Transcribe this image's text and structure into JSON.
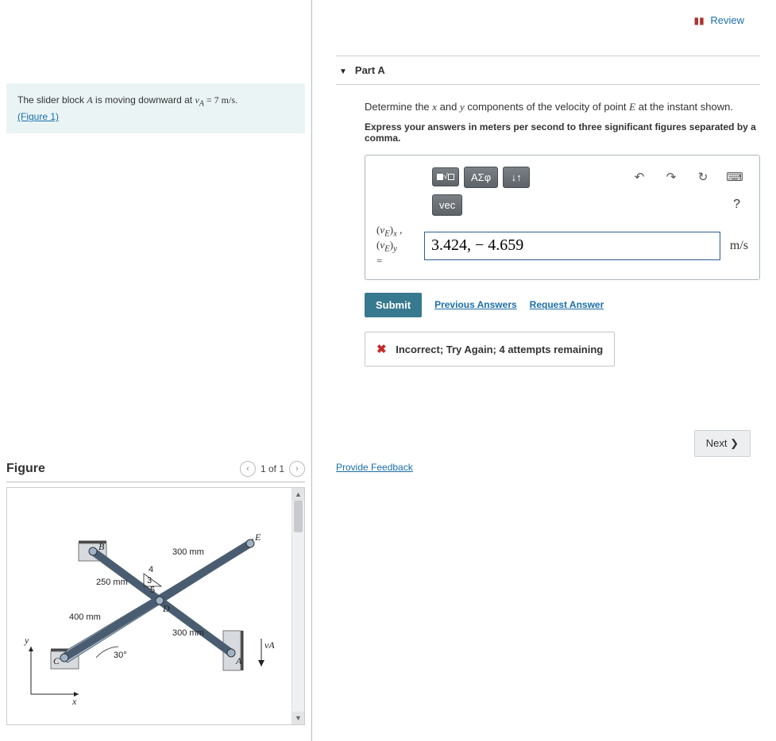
{
  "review_label": " Review",
  "problem": {
    "intro_pre": "The slider block ",
    "intro_var1": "A",
    "intro_mid": " is moving downward at ",
    "intro_eq": "v",
    "intro_sub": "A",
    "intro_val": " = 7 m/s.",
    "figure_link": "(Figure 1)"
  },
  "part": {
    "label": "Part A",
    "desc_pre": "Determine the ",
    "desc_x": "x",
    "desc_mid1": " and ",
    "desc_y": "y",
    "desc_mid2": " components of the velocity of point ",
    "desc_E": "E",
    "desc_post": " at the instant shown.",
    "instructions": "Express your answers in meters per second to three significant figures separated by a comma."
  },
  "toolbar": {
    "templates": "▢√▢",
    "greek": "ΑΣφ",
    "updown": "↓↑",
    "undo": "↶",
    "redo": "↷",
    "reset": "↻",
    "keyboard": "⌨",
    "vec": "vec",
    "help": "?"
  },
  "answer": {
    "label_x": "(vE)x",
    "label_y": "(vE)y",
    "label_eq": "=",
    "value": "3.424, − 4.659",
    "unit": "m/s"
  },
  "actions": {
    "submit": "Submit",
    "previous": "Previous Answers",
    "request": "Request Answer"
  },
  "feedback": {
    "text_pre": "Incorrect; Try Again; ",
    "attempts": "4 attempts remaining"
  },
  "footer": {
    "provide": "Provide Feedback",
    "next": "Next ❯"
  },
  "figure": {
    "title": "Figure",
    "pager": "1 of 1",
    "labels": {
      "B": "B",
      "E": "E",
      "D": "D",
      "A": "A",
      "C": "C",
      "y": "y",
      "x": "x",
      "vA": "vA",
      "d300a": "300 mm",
      "d300b": "300 mm",
      "d250": "250 mm",
      "d400": "400 mm",
      "ang30": "30°",
      "n3": "3",
      "n4": "4",
      "n5": "5"
    }
  }
}
